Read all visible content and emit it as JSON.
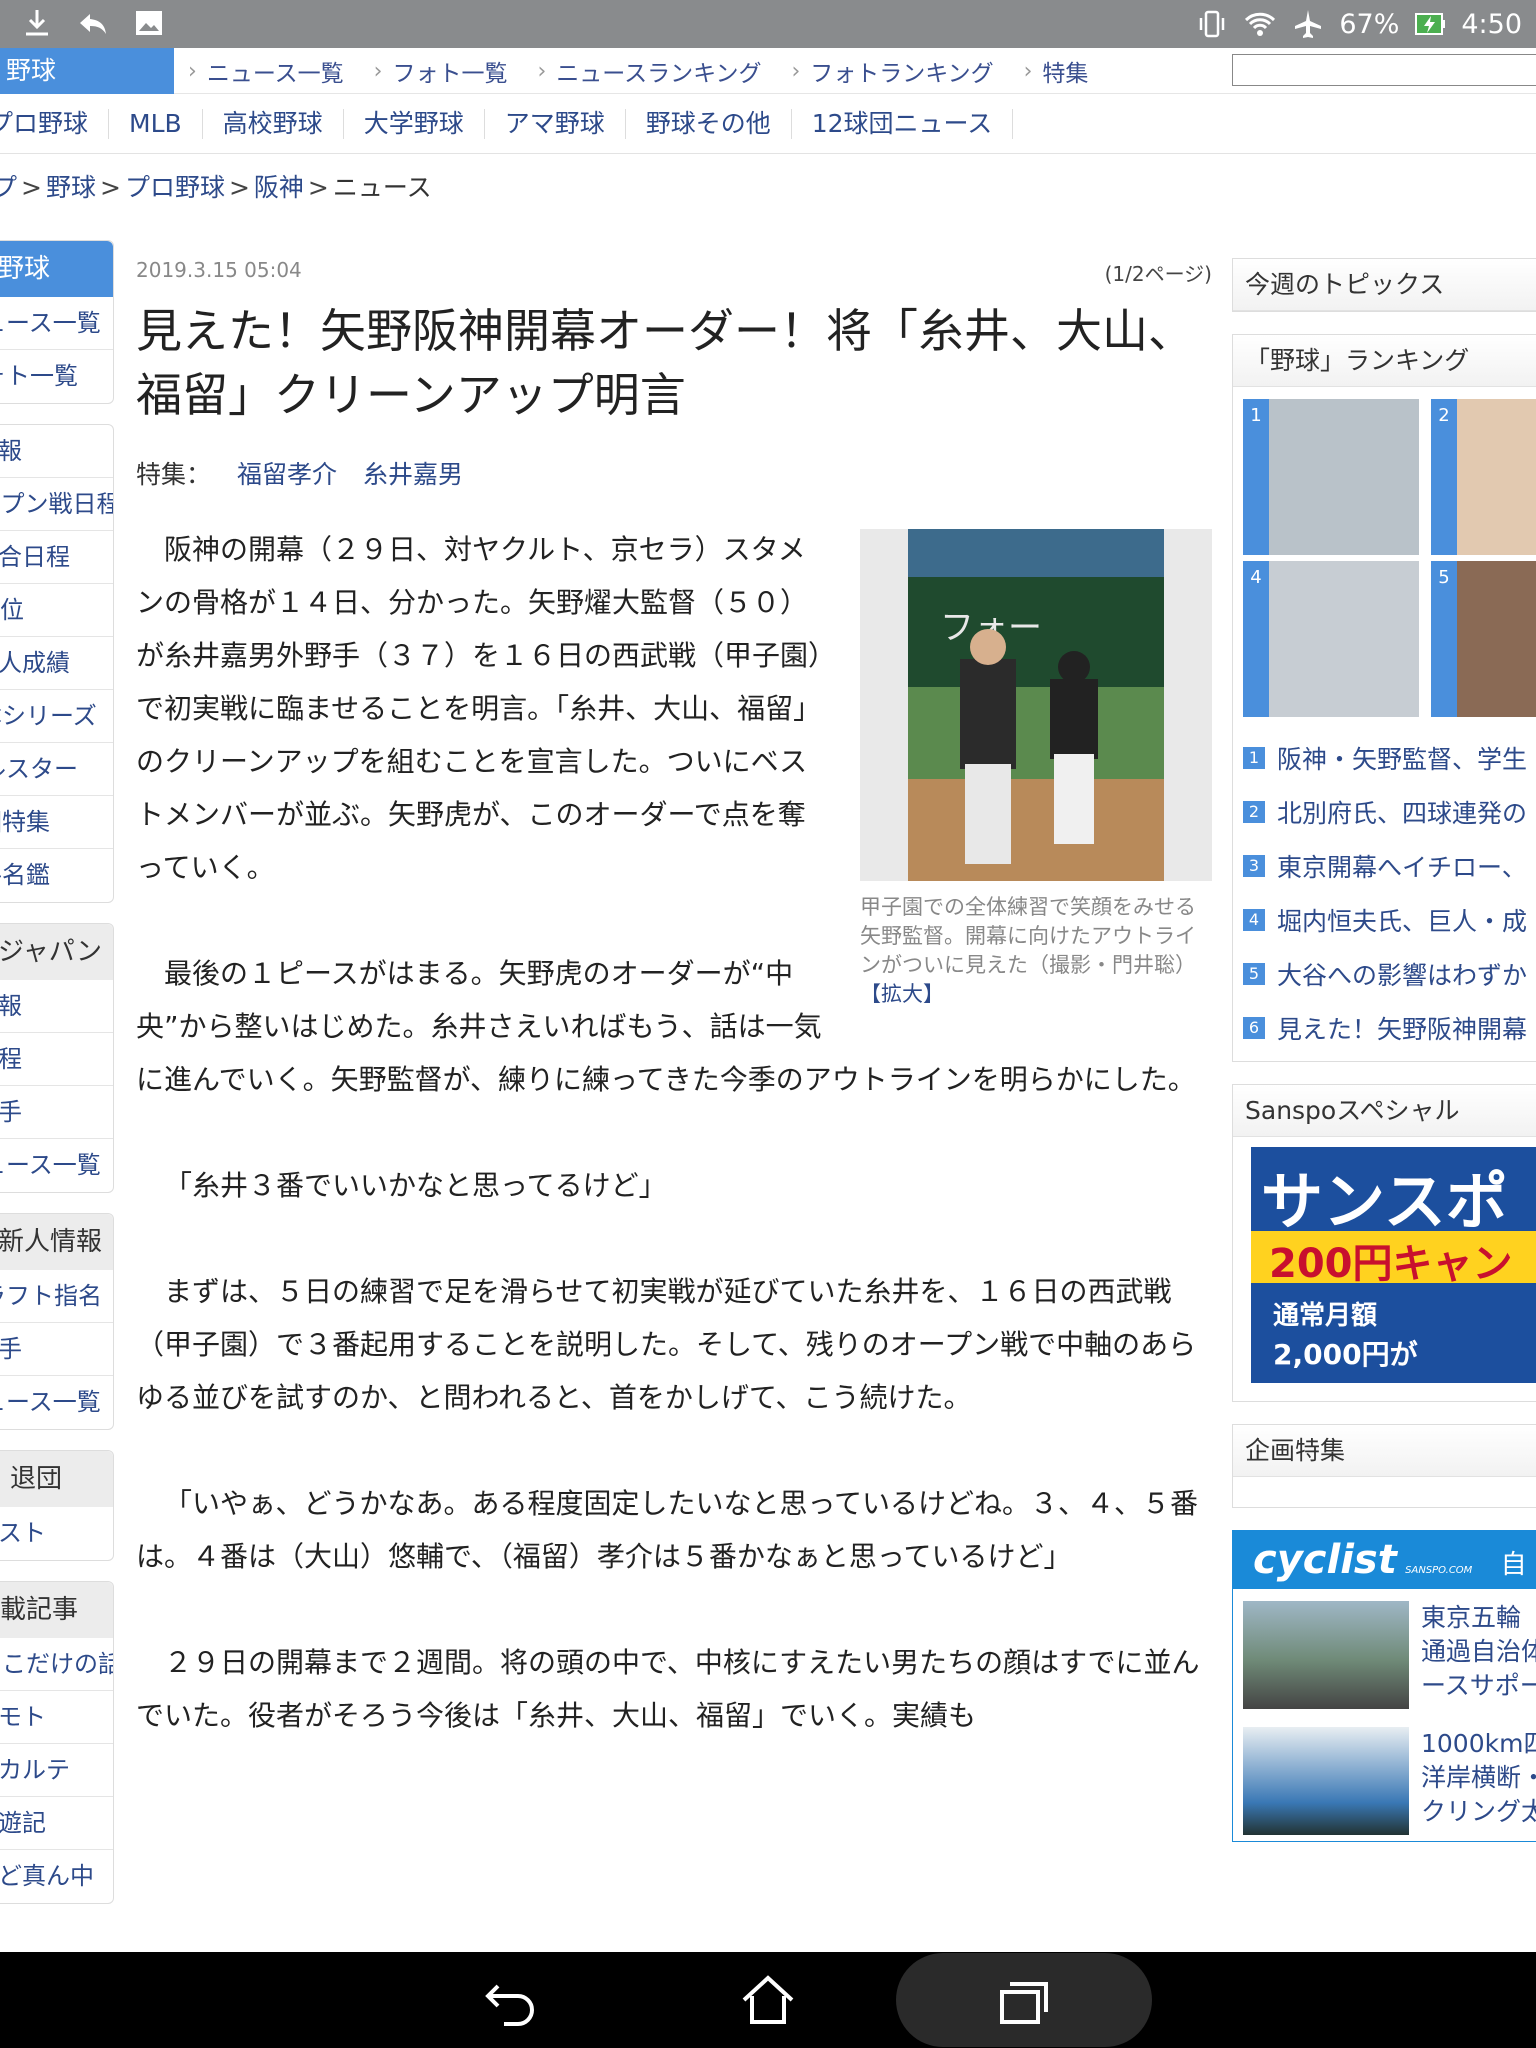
{
  "status_bar": {
    "battery": "67%",
    "time": "4:50",
    "icons": [
      "download-icon",
      "reply-icon",
      "image-icon",
      "vibrate-icon",
      "wifi-icon",
      "airplane-icon",
      "battery-charging-icon"
    ]
  },
  "top_nav": {
    "category": "野球",
    "links": [
      "ニュース一覧",
      "フォト一覧",
      "ニュースランキング",
      "フォトランキング",
      "特集"
    ]
  },
  "sub_nav": {
    "items": [
      "プロ野球",
      "MLB",
      "高校野球",
      "大学野球",
      "アマ野球",
      "野球その他",
      "12球団ニュース"
    ]
  },
  "breadcrumb": {
    "items": [
      "トップ",
      "野球",
      "プロ野球",
      "阪神"
    ],
    "current": "ニュース"
  },
  "left_nav": {
    "head": "野球",
    "group1": [
      "ニュース一覧",
      "フォト一覧"
    ],
    "group2": [
      "速報",
      "オープン戦日程",
      "試合日程",
      "順位",
      "個人成績",
      "日本シリーズ",
      "オールスター",
      "球団特集",
      "選手名鑑"
    ],
    "group3_head": "侍ジャパン",
    "group3": [
      "速報",
      "日程",
      "選手",
      "ニュース一覧"
    ],
    "group4_head": "新人情報",
    "group4": [
      "ドラフト指名",
      "選手",
      "ニュース一覧"
    ],
    "group5_head": "退団",
    "group5": [
      "リスト"
    ],
    "group6_head": "連載記事",
    "group6": [
      "ここだけの話",
      "リモト",
      "カルテ",
      "遊記",
      "ど真ん中"
    ]
  },
  "article": {
    "date": "2019.3.15 05:04",
    "page": "(1/2ページ)",
    "headline": "見えた！矢野阪神開幕オーダー！将「糸井、大山、福留」クリーンアップ明言",
    "tags_label": "特集：",
    "tags": [
      "福留孝介",
      "糸井嘉男"
    ],
    "paragraphs": [
      "阪神の開幕（２９日、対ヤクルト、京セラ）スタメンの骨格が１４日、分かった。矢野燿大監督（５０）が糸井嘉男外野手（３７）を１６日の西武戦（甲子園）で初実戦に臨ませることを明言。「糸井、大山、福留」のクリーンアップを組むことを宣言した。ついにベストメンバーが並ぶ。矢野虎が、このオーダーで点を奪っていく。",
      "最後の１ピースがはまる。矢野虎のオーダーが“中央”から整いはじめた。糸井さえいればもう、話は一気に進んでいく。矢野監督が、練りに練ってきた今季のアウトラインを明らかにした。",
      "「糸井３番でいいかなと思ってるけど」",
      "まずは、５日の練習で足を滑らせて初実戦が延びていた糸井を、１６日の西武戦（甲子園）で３番起用することを説明した。そして、残りのオープン戦で中軸のあらゆる並びを試すのか、と問われると、首をかしげて、こう続けた。",
      "「いやぁ、どうかなあ。ある程度固定したいなと思っているけどね。３、４、５番は。４番は（大山）悠輔で、（福留）孝介は５番かなぁと思っているけど」",
      "２９日の開幕まで２週間。将の頭の中で、中核にすえたい男たちの顔はすでに並んでいた。役者がそろう今後は「糸井、大山、福留」でいく。実績も"
    ],
    "photo_caption": "甲子園での全体練習で笑顔をみせる矢野監督。開幕に向けたアウトラインがついに見えた（撮影・門井聡）",
    "photo_enlarge": "【拡大】"
  },
  "right_col": {
    "topics_head": "今週のトピックス",
    "ranking_head": "「野球」ランキング",
    "thumb_numbers": [
      "1",
      "2",
      "4",
      "5"
    ],
    "ranking": [
      {
        "n": "1",
        "t": "阪神・矢野監督、学生"
      },
      {
        "n": "2",
        "t": "北別府氏、四球連発の"
      },
      {
        "n": "3",
        "t": "東京開幕へイチロー、"
      },
      {
        "n": "4",
        "t": "堀内恒夫氏、巨人・成"
      },
      {
        "n": "5",
        "t": "大谷への影響はわずか"
      },
      {
        "n": "6",
        "t": "見えた！矢野阪神開幕"
      }
    ],
    "special_head": "Sanspoスペシャル",
    "ad": {
      "line1": "サンスポ",
      "line2": "200円キャン",
      "line3": "通常月額",
      "line4": "2,000円が"
    },
    "kikaku_head": "企画特集",
    "cyclist": {
      "logo": "cyclist",
      "sublogo": "SANSPO.COM",
      "tag": "自転",
      "items": [
        {
          "lines": [
            "東京五輪",
            "通過自治体",
            "ースサポー"
          ]
        },
        {
          "lines": [
            "1000km四",
            "洋岸横断・",
            "クリング太"
          ]
        }
      ]
    }
  },
  "colors": {
    "accent_blue": "#4a8fdc",
    "link_blue": "#2d4a8a",
    "status_gray": "#898b8d"
  }
}
